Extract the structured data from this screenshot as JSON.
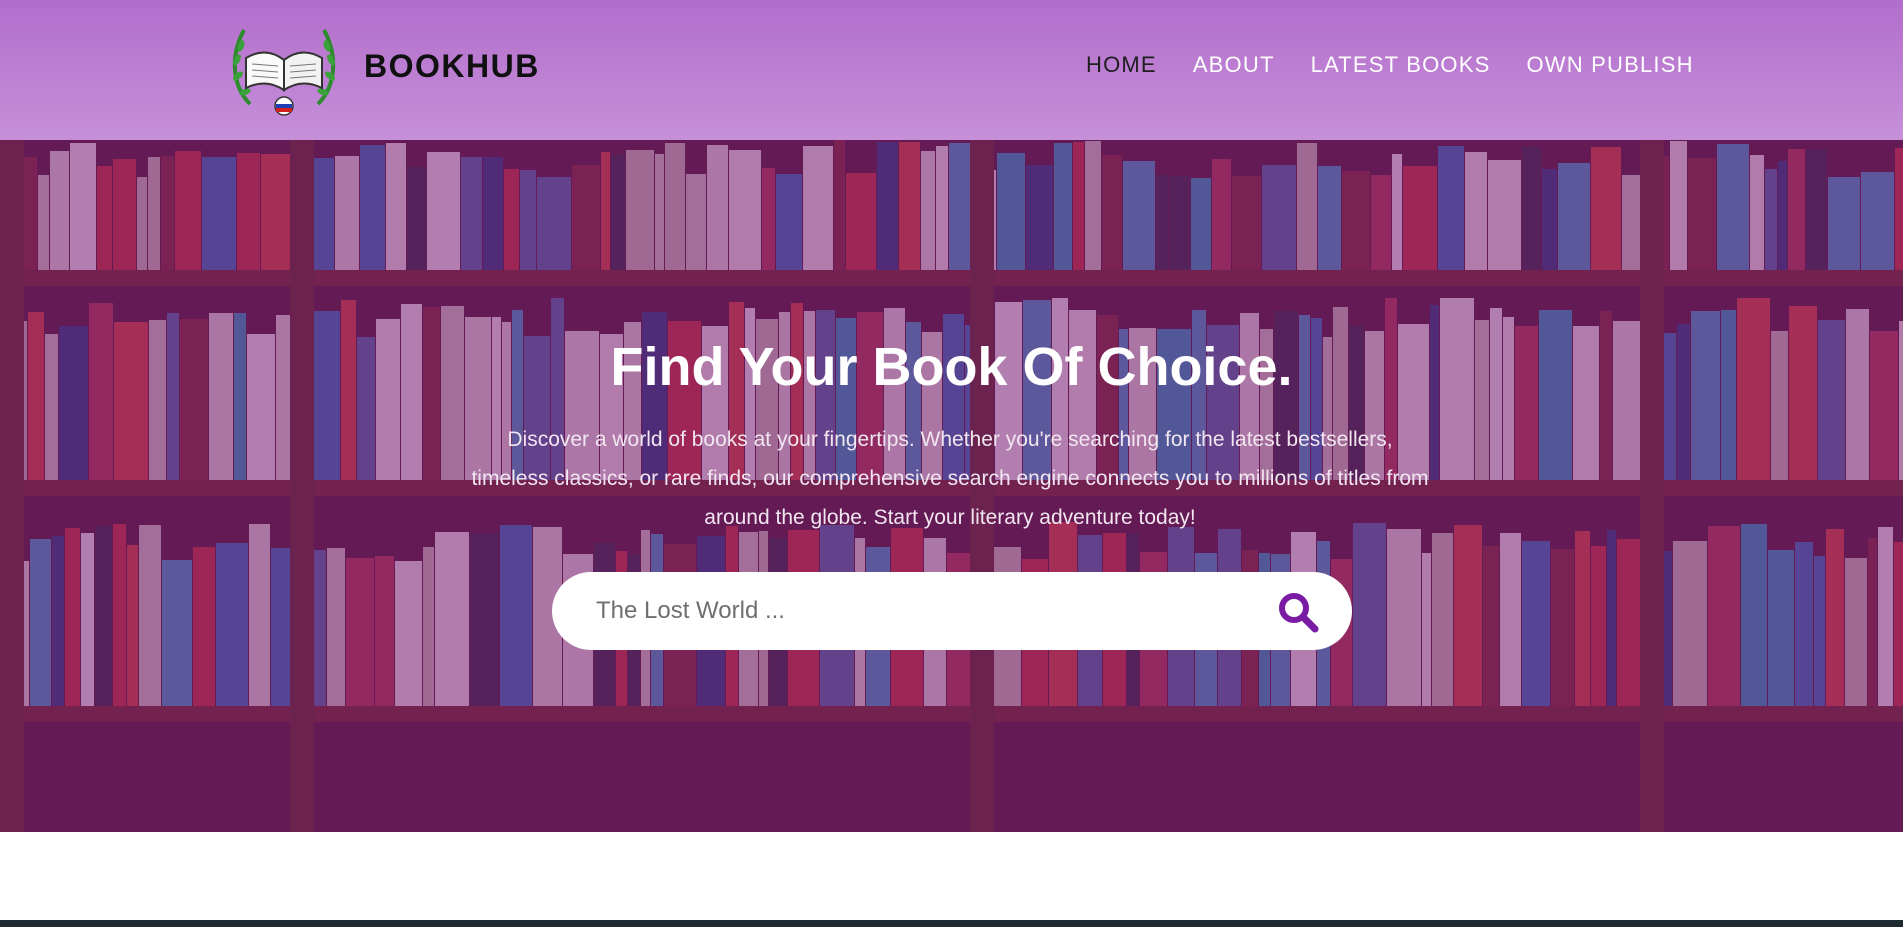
{
  "header": {
    "brand": "BOOKHUB",
    "nav": [
      {
        "label": "HOME",
        "active": true
      },
      {
        "label": "ABOUT",
        "active": false
      },
      {
        "label": "LATEST BOOKS",
        "active": false
      },
      {
        "label": "OWN PUBLISH",
        "active": false
      }
    ]
  },
  "hero": {
    "title": "Find Your Book Of Choice.",
    "subtitle": "Discover a world of books at your fingertips. Whether you're searching for the latest bestsellers, timeless classics, or rare finds, our comprehensive search engine connects you to millions of titles from around the globe. Start your literary adventure today!",
    "search": {
      "placeholder": "The Lost World ...",
      "value": ""
    }
  },
  "colors": {
    "header_bg": "#b26dcc",
    "overlay": "#7a1c76",
    "accent": "#7a1ca3"
  },
  "icons": {
    "logo": "open-book-laurel-icon",
    "search": "search-icon"
  }
}
